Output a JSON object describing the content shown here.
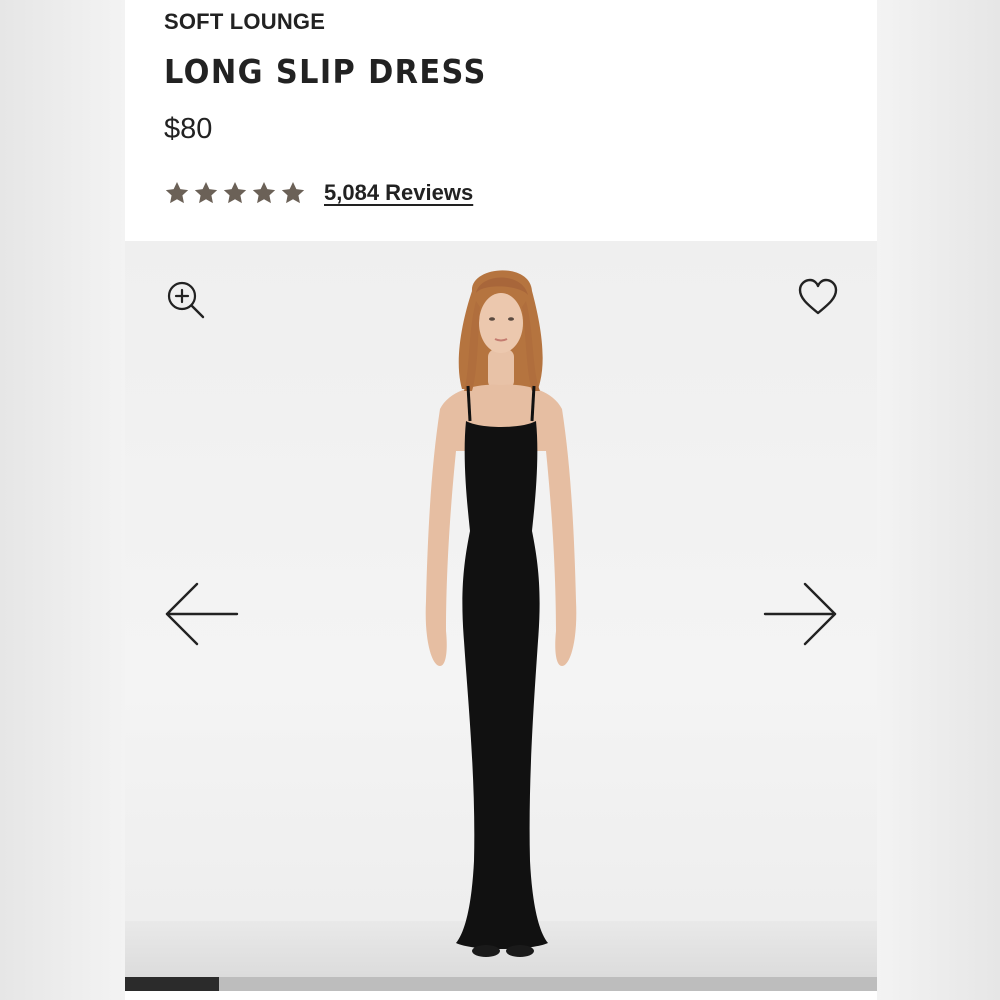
{
  "product": {
    "collection": "SOFT LOUNGE",
    "name": "LONG SLIP DRESS",
    "price": "$80",
    "rating": {
      "stars": 5,
      "filled": 5,
      "reviews_label": "5,084 Reviews"
    }
  },
  "gallery": {
    "icons": {
      "zoom": "zoom-in-icon",
      "favorite": "heart-icon",
      "previous": "arrow-left-icon",
      "next": "arrow-right-icon"
    },
    "progress_fraction": 0.125
  },
  "colors": {
    "text": "#222222",
    "star": "#6b6157",
    "dress": "#111111",
    "progress_fill": "#2b2b2b",
    "progress_track": "#bdbdbd"
  }
}
